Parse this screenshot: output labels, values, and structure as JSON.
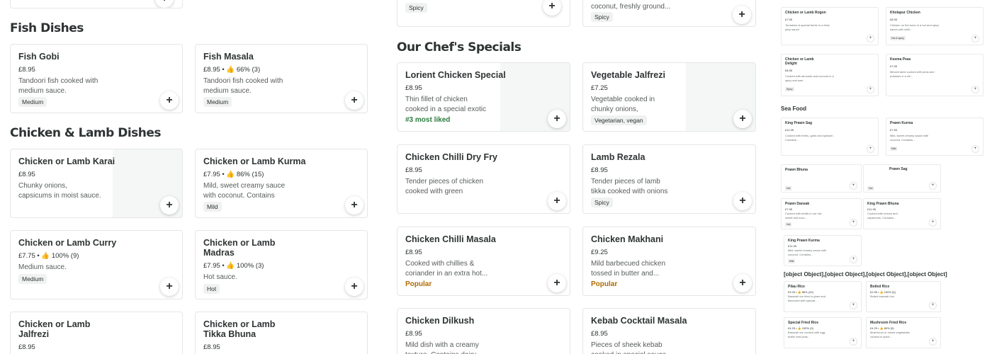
{
  "sections": {
    "fish": "Fish Dishes",
    "chicken_lamb": "Chicken & Lamb Dishes",
    "chefs": "Our Chef's Specials"
  },
  "add_label": "+",
  "top_partial": {
    "tag_mid": "Spicy",
    "desc_right": "coconut, freshly ground...",
    "tag_right": "Spicy"
  },
  "col1": [
    {
      "name": "Fish Gobi",
      "meta": "£8.95",
      "desc": "Tandoori fish cooked with medium sauce. Contains...",
      "tag": "Medium"
    },
    {
      "name": "Chicken or Lamb Karai",
      "meta": "£8.95",
      "desc": "Chunky onions, capsicums in moist sauce. Contains...",
      "tag": ""
    },
    {
      "name": "Chicken or Lamb Curry",
      "meta": "£7.75 • 👍 100% (9)",
      "desc": "Medium sauce.",
      "tag": "Medium"
    },
    {
      "name": "Chicken or Lamb Jalfrezi",
      "meta": "£8.95",
      "desc": "",
      "tag": ""
    }
  ],
  "col2": [
    {
      "name": "Fish Masala",
      "meta": "£8.95 • 👍 66% (3)",
      "desc": "Tandoori fish cooked with medium sauce. Contains...",
      "tag": "Medium"
    },
    {
      "name": "Chicken or Lamb Kurma",
      "meta": "£7.95 • 👍 86% (15)",
      "desc": "Mild, sweet creamy sauce with coconut. Contains dair...",
      "tag": "Mild"
    },
    {
      "name": "Chicken or Lamb Madras",
      "meta": "£7.95 • 👍 100% (3)",
      "desc": "Hot sauce.",
      "tag": "Hot"
    },
    {
      "name": "Chicken or Lamb Tikka Bhuna",
      "meta": "£8.95",
      "desc": "",
      "tag": ""
    }
  ],
  "col3": [
    {
      "name": "Lorient Chicken Special",
      "meta": "£8.95",
      "desc": "Thin fillet of chicken cooked in a special exotic sauce...",
      "note": "#3 most liked",
      "tag": ""
    },
    {
      "name": "Chicken Chilli Dry Fry",
      "meta": "£8.95",
      "desc": "Tender pieces of chicken cooked with green chillies,...",
      "note": "",
      "tag": ""
    },
    {
      "name": "Chicken Chilli Masala",
      "meta": "£8.95",
      "desc": "Cooked with chillies & coriander in an extra hot...",
      "note": "Popular",
      "tag": ""
    },
    {
      "name": "Chicken Dilkush",
      "meta": "£8.95",
      "desc": "Mild dish with a creamy texture. Contains dairy, nut...",
      "note": "",
      "tag": ""
    }
  ],
  "col4": [
    {
      "name": "Vegetable Jalfrezi",
      "meta": "£7.25",
      "desc": "Vegetable cooked in chunky onions, capsicums, green...",
      "note": "",
      "tag": "Vegetarian, vegan"
    },
    {
      "name": "Lamb Rezala",
      "meta": "£8.95",
      "desc": "Tender pieces of lamb tikka cooked with onions and...",
      "note": "",
      "tag": "Spicy"
    },
    {
      "name": "Chicken Makhani",
      "meta": "£9.25",
      "desc": "Mild barbecued chicken tossed in butter and...",
      "note": "Popular",
      "tag": ""
    },
    {
      "name": "Kebab Cocktail Masala",
      "meta": "£8.95",
      "desc": "Pieces of sheek kebab cooked in special sauce...",
      "note": "",
      "tag": ""
    }
  ],
  "minimap": {
    "sea_food": "Sea Food",
    "rice": [
      {
        "name": "Pilau Rice",
        "price": "£3.25 • 👍 86% (24)",
        "desc": "Basmati rice fried in ghee and flavoured with special...",
        "tag": ""
      },
      {
        "name": "Boiled Rice",
        "price": "£2.95 • 👍 100% (6)",
        "desc": "Boiled basmati rice.",
        "tag": ""
      },
      {
        "name": "Special Fried Rice",
        "price": "£4.25 • 👍 100% (3)",
        "desc": "Basmati rice cooked with egg, butter and peas...",
        "tag": ""
      },
      {
        "name": "Mushroom Fried Rice",
        "price": "£4.25 • 👍 80% (5)",
        "desc": "Mushroom or mixed vegetables cooked in spice...",
        "tag": ""
      }
    ],
    "top": [
      {
        "name": "Chicken or Lamb Rogon",
        "price": "£7.95",
        "desc": "Tomatoes & special herbs in a thick juicy sauce.",
        "tag": ""
      },
      {
        "name": "Kholapur Chicken",
        "price": "£8.95",
        "desc": "Chicken on the bone in a hot and spicy sauce with chilli...",
        "tag": "Hot & spicy"
      },
      {
        "name": "Chicken or Lamb Delight",
        "price": "£8.95",
        "desc": "Cooked with almonds and coconut in a spicy and swe...",
        "tag": "Spicy"
      },
      {
        "name": "Keema Peas",
        "price": "£7.95",
        "desc": "Minced lamb cooked with peas and potatoes in a mil...",
        "tag": ""
      }
    ],
    "sea": [
      {
        "name": "King Prawn Sag",
        "price": "£11.95",
        "desc": "Cooked with herbs, garlic and spinach. Contains...",
        "tag": ""
      },
      {
        "name": "Prawn Kurma",
        "price": "£7.95",
        "desc": "Mild, sweet creamy sauce with coconut. Contains...",
        "tag": "Mild"
      },
      {
        "name": "Prawn Bhuna",
        "price": "",
        "desc": "",
        "tag": "Hot"
      },
      {
        "name": "Prawn Sag",
        "price": "",
        "desc": "",
        "tag": "Hot"
      },
      {
        "name": "Prawn Dansak",
        "price": "£7.95",
        "desc": "Cooked with lentils in our hot, sweet and sour...",
        "tag": "Hot"
      },
      {
        "name": "King Prawn Bhuna",
        "price": "£11.95",
        "desc": "Cooked with onions and capsicums. Contains...",
        "tag": ""
      },
      {
        "name": "King Prawn Kurma",
        "price": "£11.95",
        "desc": "Mild, sweet creamy sauce with coconut. Contains...",
        "tag": "Mild"
      }
    ]
  }
}
